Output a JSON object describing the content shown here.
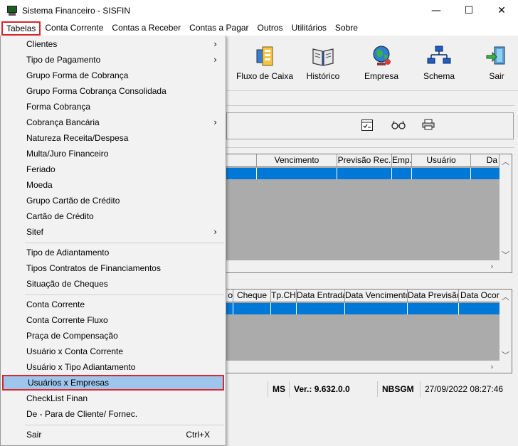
{
  "window": {
    "title": "Sistema Financeiro - SISFIN",
    "minimize": "—",
    "maximize": "☐",
    "close": "✕"
  },
  "menubar": {
    "items": [
      "Tabelas",
      "Conta Corrente",
      "Contas a Receber",
      "Contas a Pagar",
      "Outros",
      "Utilitários",
      "Sobre"
    ]
  },
  "toolbar": {
    "buttons": [
      {
        "label": "Fluxo de Caixa",
        "icon": "cash-flow-icon"
      },
      {
        "label": "Histórico",
        "icon": "history-book-icon"
      },
      {
        "label": "Empresa",
        "icon": "company-globe-icon"
      },
      {
        "label": "Schema",
        "icon": "schema-tree-icon"
      },
      {
        "label": "Sair",
        "icon": "exit-door-icon"
      }
    ]
  },
  "action_toolbar": {
    "icons": [
      "checklist-icon",
      "glasses-icon",
      "printer-icon"
    ]
  },
  "grid_top": {
    "columns": [
      "Vencimento",
      "Previsão Rec.",
      "Emp.",
      "Usuário",
      "Da"
    ]
  },
  "grid_bottom": {
    "columns": [
      "o",
      "Cheque",
      "Tp.CH",
      "Data Entrada",
      "Data Vencimento",
      "Data Previsão",
      "Data Ocorrê"
    ]
  },
  "statusbar": {
    "region": "MS",
    "version": "Ver.: 9.632.0.0",
    "user": "NBSGM",
    "datetime": "27/09/2022 08:27:46"
  },
  "dropdown_menu": {
    "items": [
      {
        "label": "Clientes",
        "submenu": "›"
      },
      {
        "label": "Tipo de Pagamento",
        "submenu": "›"
      },
      {
        "label": "Grupo Forma de Cobrança"
      },
      {
        "label": "Grupo Forma Cobrança Consolidada"
      },
      {
        "label": "Forma Cobrança"
      },
      {
        "label": "Cobrança Bancária",
        "submenu": "›"
      },
      {
        "label": "Natureza Receita/Despesa"
      },
      {
        "label": "Multa/Juro Financeiro"
      },
      {
        "label": "Feriado"
      },
      {
        "label": "Moeda"
      },
      {
        "label": "Grupo Cartão de Crédito"
      },
      {
        "label": "Cartão de Crédito"
      },
      {
        "label": "Sitef",
        "submenu": "›"
      },
      {
        "label": "Tipo de Adiantamento"
      },
      {
        "label": "Tipos Contratos de Financiamentos"
      },
      {
        "label": "Situação de Cheques"
      },
      {
        "label": "Conta Corrente"
      },
      {
        "label": "Conta Corrente Fluxo"
      },
      {
        "label": "Praça de Compensação"
      },
      {
        "label": "Usuário x Conta Corrente"
      },
      {
        "label": "Usuário x Tipo Adiantamento"
      },
      {
        "label": "Usuários x Empresas"
      },
      {
        "label": "CheckList Finan"
      },
      {
        "label": "De - Para de Cliente/ Fornec."
      },
      {
        "label": "Sair",
        "shortcut": "Ctrl+X"
      }
    ],
    "highlighted": "Usuários x Empresas"
  },
  "colors": {
    "highlight_border": "#d9262f",
    "selection_blue": "#0078d7",
    "menu_highlight": "#9ec6ec"
  }
}
